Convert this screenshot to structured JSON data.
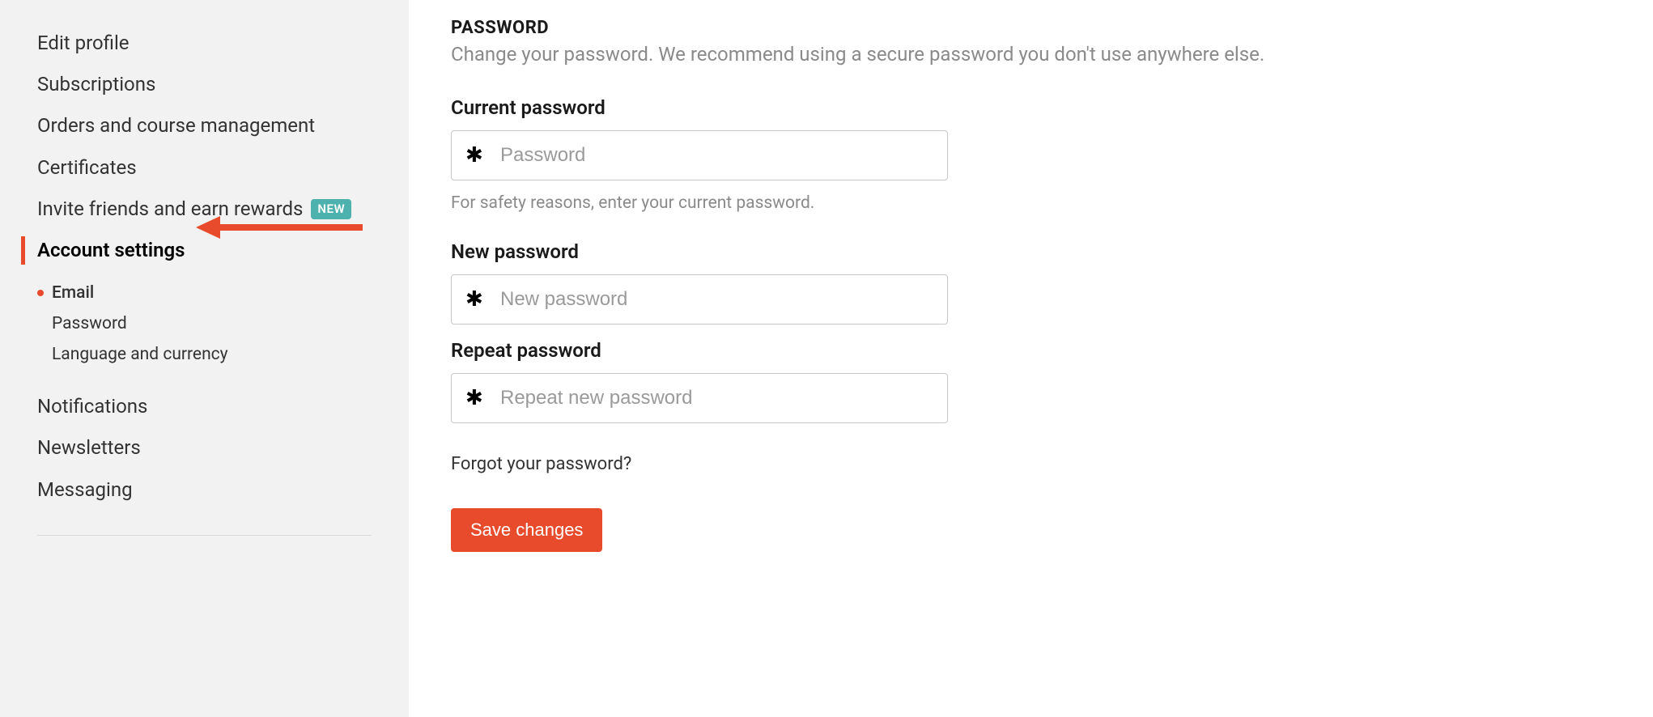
{
  "sidebar": {
    "items": [
      {
        "label": "Edit profile"
      },
      {
        "label": "Subscriptions"
      },
      {
        "label": "Orders and course management"
      },
      {
        "label": "Certificates"
      },
      {
        "label": "Invite friends and earn rewards",
        "badge": "NEW"
      },
      {
        "label": "Account settings",
        "active": true
      },
      {
        "label": "Notifications"
      },
      {
        "label": "Newsletters"
      },
      {
        "label": "Messaging"
      }
    ],
    "subitems": [
      {
        "label": "Email",
        "current": true
      },
      {
        "label": "Password"
      },
      {
        "label": "Language and currency"
      }
    ]
  },
  "main": {
    "heading": "PASSWORD",
    "description": "Change your password. We recommend using a secure password you don't use anywhere else.",
    "current_password": {
      "label": "Current password",
      "placeholder": "Password",
      "helper": "For safety reasons, enter your current password."
    },
    "new_password": {
      "label": "New password",
      "placeholder": "New password"
    },
    "repeat_password": {
      "label": "Repeat password",
      "placeholder": "Repeat new password"
    },
    "forgot_link": "Forgot your password?",
    "save_button": "Save changes"
  },
  "colors": {
    "accent": "#e74b2c",
    "badge": "#4db1ad"
  }
}
